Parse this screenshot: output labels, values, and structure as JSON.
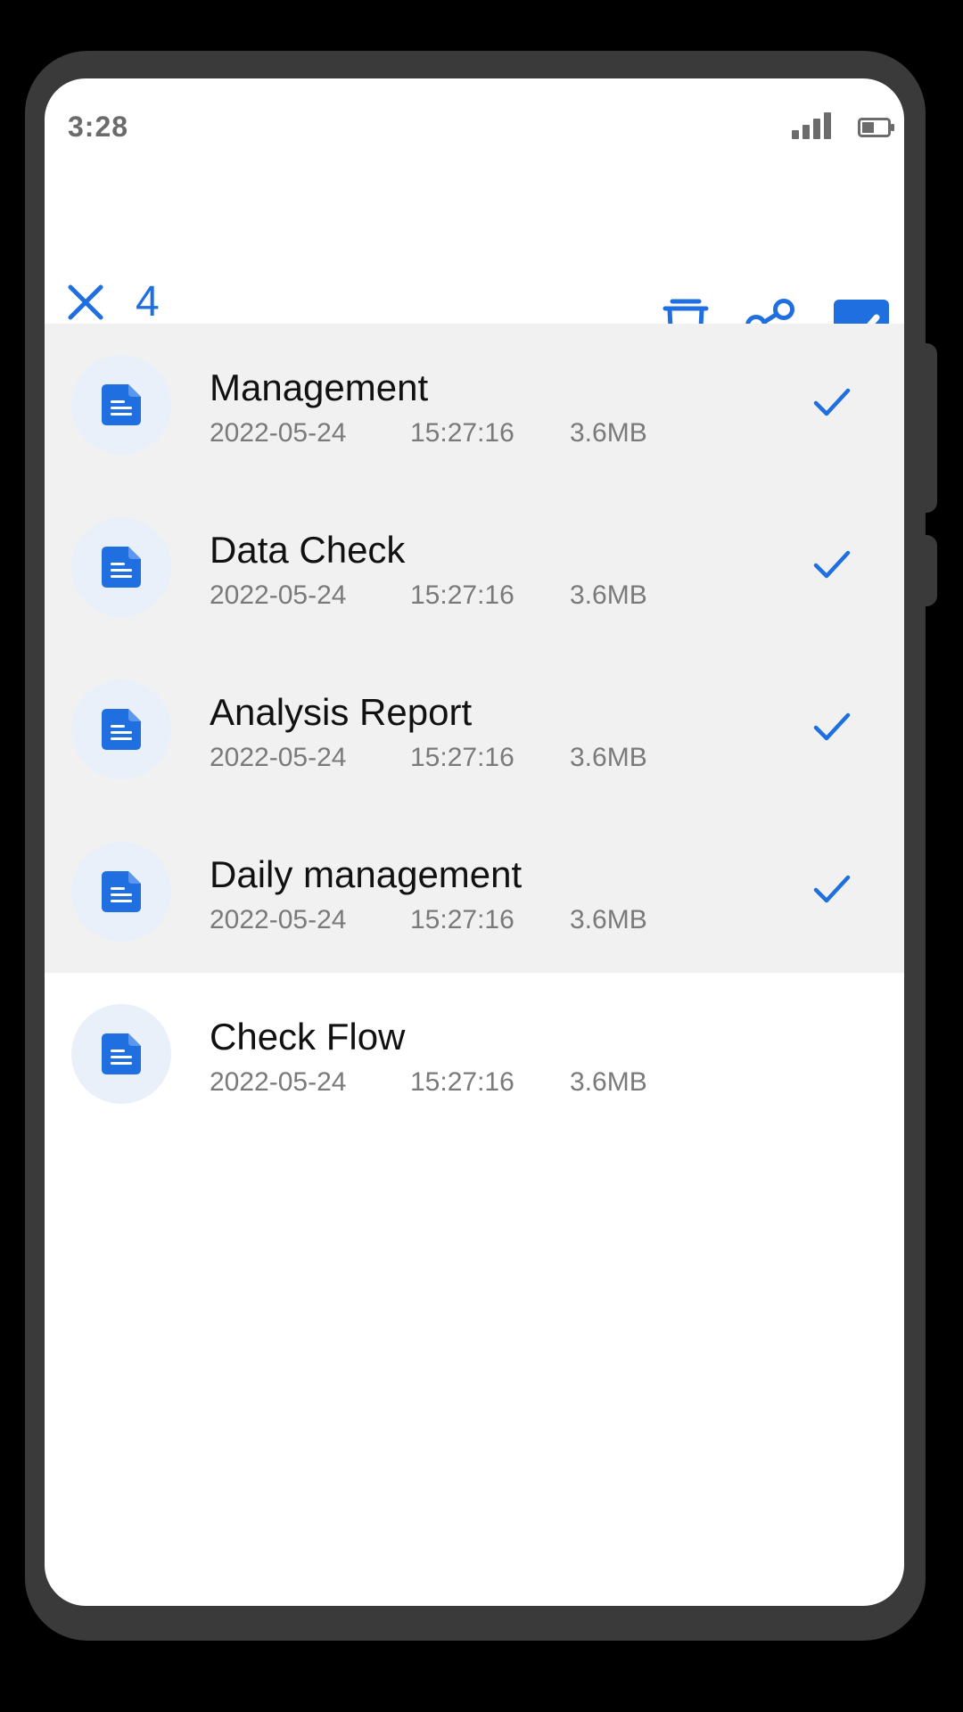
{
  "status_bar": {
    "time": "3:28",
    "signal_icon": "cellular-signal-icon",
    "battery_icon": "battery-icon"
  },
  "toolbar": {
    "close_icon": "close-icon",
    "selected_count": "4",
    "delete_icon": "trash-icon",
    "share_icon": "share-icon",
    "select_all_icon": "checkbox-checked-icon"
  },
  "colors": {
    "accent": "#1f6fe0",
    "selected_row_bg": "#f1f1f1",
    "icon_circle_bg": "#eaf0fa",
    "meta_text": "#7a7a7a"
  },
  "files": [
    {
      "name": "Management",
      "date": "2022-05-24",
      "time": "15:27:16",
      "size": "3.6MB",
      "selected": true
    },
    {
      "name": "Data Check",
      "date": "2022-05-24",
      "time": "15:27:16",
      "size": "3.6MB",
      "selected": true
    },
    {
      "name": "Analysis Report",
      "date": "2022-05-24",
      "time": "15:27:16",
      "size": "3.6MB",
      "selected": true
    },
    {
      "name": "Daily management",
      "date": "2022-05-24",
      "time": "15:27:16",
      "size": "3.6MB",
      "selected": true
    },
    {
      "name": "Check Flow",
      "date": "2022-05-24",
      "time": "15:27:16",
      "size": "3.6MB",
      "selected": false
    }
  ]
}
